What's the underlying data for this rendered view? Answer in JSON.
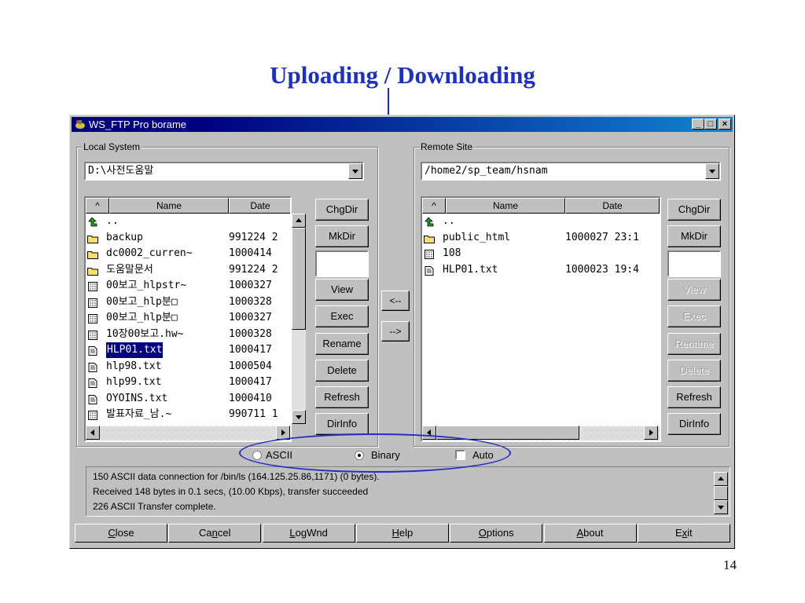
{
  "slide": {
    "title": "Uploading / Downloading",
    "page_number": "14"
  },
  "window": {
    "title": "WS_FTP Pro borame",
    "controls": {
      "minimize": "_",
      "maximize": "□",
      "close": "×"
    }
  },
  "local": {
    "label": "Local System",
    "path": "D:\\사전도움말",
    "columns": {
      "sort": "^",
      "name": "Name",
      "date": "Date"
    },
    "files": [
      {
        "icon": "up-folder-icon",
        "name": "..",
        "date": ""
      },
      {
        "icon": "folder-icon",
        "name": "backup",
        "date": "991224 2"
      },
      {
        "icon": "folder-icon",
        "name": "dc0002_curren~",
        "date": "1000414"
      },
      {
        "icon": "folder-icon",
        "name": "도움말문서",
        "date": "991224 2"
      },
      {
        "icon": "binary-file-icon",
        "name": "00보고_hlpstr~",
        "date": "1000327"
      },
      {
        "icon": "binary-file-icon",
        "name": "00보고_hlp분□",
        "date": "1000328"
      },
      {
        "icon": "binary-file-icon",
        "name": "00보고_hlp분□",
        "date": "1000327"
      },
      {
        "icon": "binary-file-icon",
        "name": "10장00보고.hw~",
        "date": "1000328"
      },
      {
        "icon": "text-file-icon",
        "name": "HLP01.txt",
        "date": "1000417",
        "selected": true
      },
      {
        "icon": "text-file-icon",
        "name": "hlp98.txt",
        "date": "1000504"
      },
      {
        "icon": "text-file-icon",
        "name": "hlp99.txt",
        "date": "1000417"
      },
      {
        "icon": "text-file-icon",
        "name": "OYOINS.txt",
        "date": "1000410"
      },
      {
        "icon": "binary-file-icon",
        "name": "발표자료_남.~",
        "date": "990711 1"
      }
    ],
    "buttons": {
      "chgdir": "ChgDir",
      "mkdir": "MkDir",
      "view": "View",
      "exec": "Exec",
      "rename": "Rename",
      "delete": "Delete",
      "refresh": "Refresh",
      "dirinfo": "DirInfo"
    }
  },
  "transfer": {
    "download": "<--",
    "upload": "-->"
  },
  "remote": {
    "label": "Remote Site",
    "path": "/home2/sp_team/hsnam",
    "columns": {
      "sort": "^",
      "name": "Name",
      "date": "Date"
    },
    "files": [
      {
        "icon": "up-folder-icon",
        "name": "..",
        "date": ""
      },
      {
        "icon": "folder-icon",
        "name": "public_html",
        "date": "1000027 23:1"
      },
      {
        "icon": "binary-file-icon",
        "name": "108",
        "date": ""
      },
      {
        "icon": "text-file-icon",
        "name": "HLP01.txt",
        "date": "1000023 19:4"
      }
    ],
    "buttons": {
      "chgdir": "ChgDir",
      "mkdir": "MkDir",
      "view": "View",
      "exec": "Exec",
      "rename": "Rename",
      "delete": "Delete",
      "refresh": "Refresh",
      "dirinfo": "DirInfo"
    }
  },
  "mode": {
    "ascii": "ASCII",
    "binary": "Binary",
    "auto": "Auto",
    "selected": "binary"
  },
  "log": [
    "150 ASCII data connection for /bin/ls (164.125.25.86,1171) (0 bytes).",
    "Received 148 bytes in 0.1 secs, (10.00 Kbps), transfer succeeded",
    "226 ASCII Transfer complete."
  ],
  "bottom": [
    {
      "label": "Close",
      "mn": "C",
      "rest": "lose"
    },
    {
      "label": "Cancel",
      "pre": "Ca",
      "mn": "n",
      "rest": "cel"
    },
    {
      "label": "LogWnd",
      "mn": "L",
      "rest": "ogWnd"
    },
    {
      "label": "Help",
      "mn": "H",
      "rest": "elp"
    },
    {
      "label": "Options",
      "mn": "O",
      "rest": "ptions"
    },
    {
      "label": "About",
      "mn": "A",
      "rest": "bout"
    },
    {
      "label": "Exit",
      "pre": "E",
      "mn": "x",
      "rest": "it"
    }
  ],
  "colors": {
    "title_blue": "#1a30c8",
    "titlebar": "#000080",
    "selection": "#000080",
    "face": "#c0c0c0"
  }
}
